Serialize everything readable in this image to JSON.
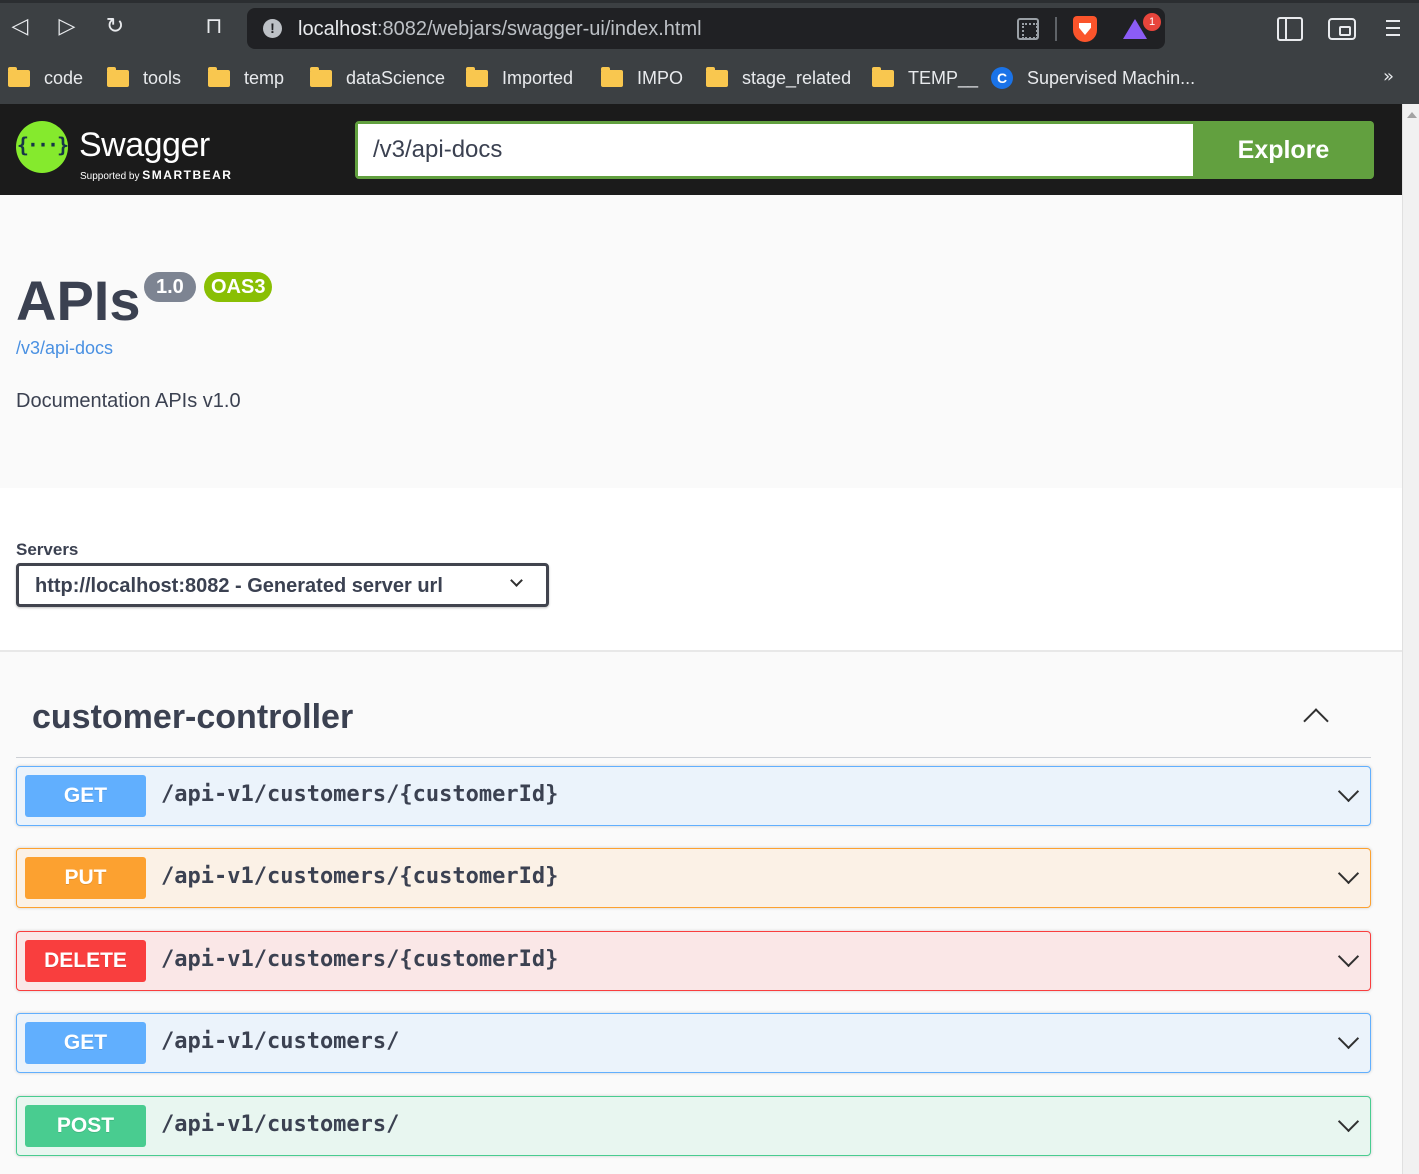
{
  "browser": {
    "url_host": "localhost",
    "url_rest": ":8082/webjars/swagger-ui/index.html",
    "rewards_count": "1",
    "bookmarks": [
      {
        "label": "code",
        "type": "folder"
      },
      {
        "label": "tools",
        "type": "folder"
      },
      {
        "label": "temp",
        "type": "folder"
      },
      {
        "label": "dataScience",
        "type": "folder"
      },
      {
        "label": "Imported",
        "type": "folder"
      },
      {
        "label": "IMPO",
        "type": "folder"
      },
      {
        "label": "stage_related",
        "type": "folder"
      },
      {
        "label": "TEMP__",
        "type": "folder"
      },
      {
        "label": "Supervised Machin...",
        "type": "site",
        "icon_letter": "C"
      }
    ],
    "more_label": "»"
  },
  "topbar": {
    "logo_text": "Swagger",
    "logo_glyph": "{···}",
    "supported_by": "Supported by",
    "smartbear": "SMARTBEAR",
    "explore_input_value": "/v3/api-docs",
    "explore_button": "Explore"
  },
  "info": {
    "title": "APIs",
    "version": "1.0",
    "oas": "OAS3",
    "link": "/v3/api-docs",
    "description": "Documentation APIs v1.0"
  },
  "servers": {
    "label": "Servers",
    "selected": "http://localhost:8082 - Generated server url"
  },
  "tag": {
    "name": "customer-controller"
  },
  "operations": [
    {
      "method": "GET",
      "path": "/api-v1/customers/{customerId}"
    },
    {
      "method": "PUT",
      "path": "/api-v1/customers/{customerId}"
    },
    {
      "method": "DELETE",
      "path": "/api-v1/customers/{customerId}"
    },
    {
      "method": "GET",
      "path": "/api-v1/customers/"
    },
    {
      "method": "POST",
      "path": "/api-v1/customers/"
    }
  ],
  "colors": {
    "get": "#61affe",
    "put": "#fca130",
    "delete": "#f93e3e",
    "post": "#49cc90",
    "explore": "#62a03f",
    "logo": "#85ea2d"
  }
}
